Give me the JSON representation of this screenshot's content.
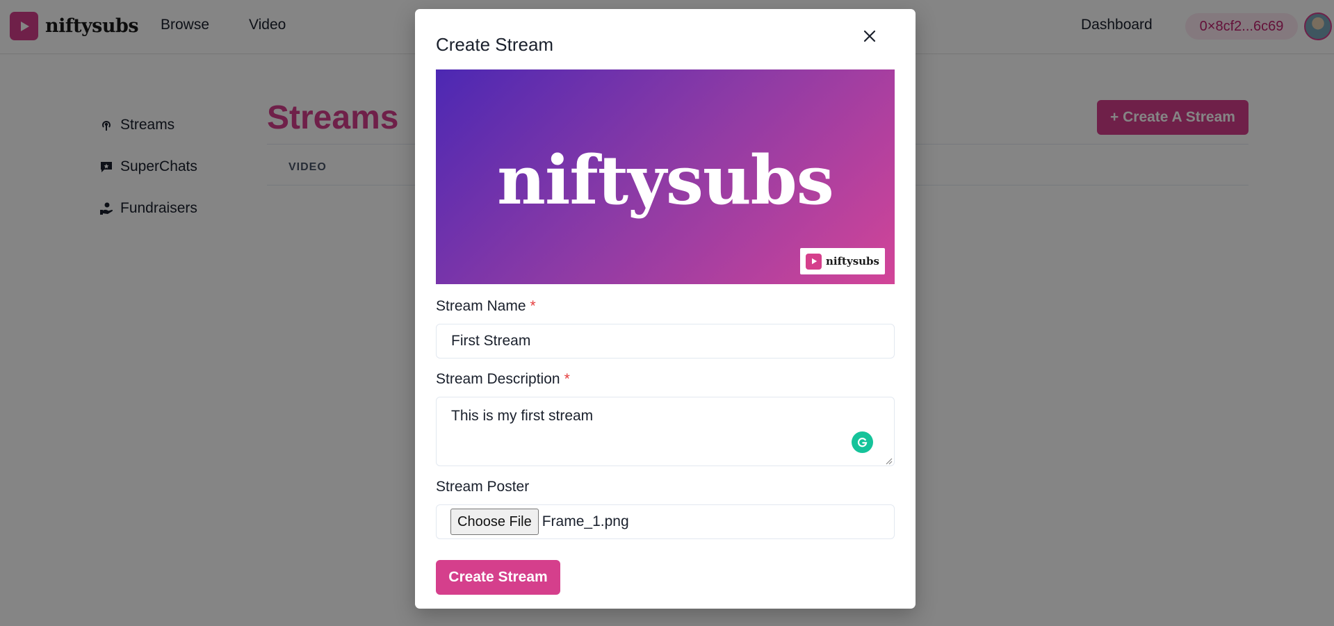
{
  "brand": {
    "name": "niftysubs"
  },
  "topnav": {
    "browse": "Browse",
    "video": "Video",
    "dashboard": "Dashboard",
    "wallet": "0×8cf2...6c69"
  },
  "sidebar": {
    "items": [
      {
        "label": "Streams",
        "icon": "broadcast-icon"
      },
      {
        "label": "SuperChats",
        "icon": "chat-icon"
      },
      {
        "label": "Fundraisers",
        "icon": "donate-hand-icon"
      }
    ]
  },
  "main": {
    "title": "Streams",
    "create_button": "+ Create A Stream",
    "table": {
      "columns": [
        "VIDEO"
      ]
    }
  },
  "modal": {
    "title": "Create Stream",
    "close_icon": "close-icon",
    "poster_preview": {
      "text": "niftysubs",
      "badge_text": "niftysubs"
    },
    "fields": {
      "name": {
        "label": "Stream Name",
        "required_mark": "*",
        "value": "First Stream"
      },
      "description": {
        "label": "Stream Description",
        "required_mark": "*",
        "value": "This is my first stream"
      },
      "poster": {
        "label": "Stream Poster",
        "button": "Choose File",
        "file_name": "Frame_1.png"
      }
    },
    "submit": "Create Stream"
  },
  "colors": {
    "accent": "#d53f8c",
    "required": "#e53e3e",
    "grammarly": "#15c39a"
  }
}
